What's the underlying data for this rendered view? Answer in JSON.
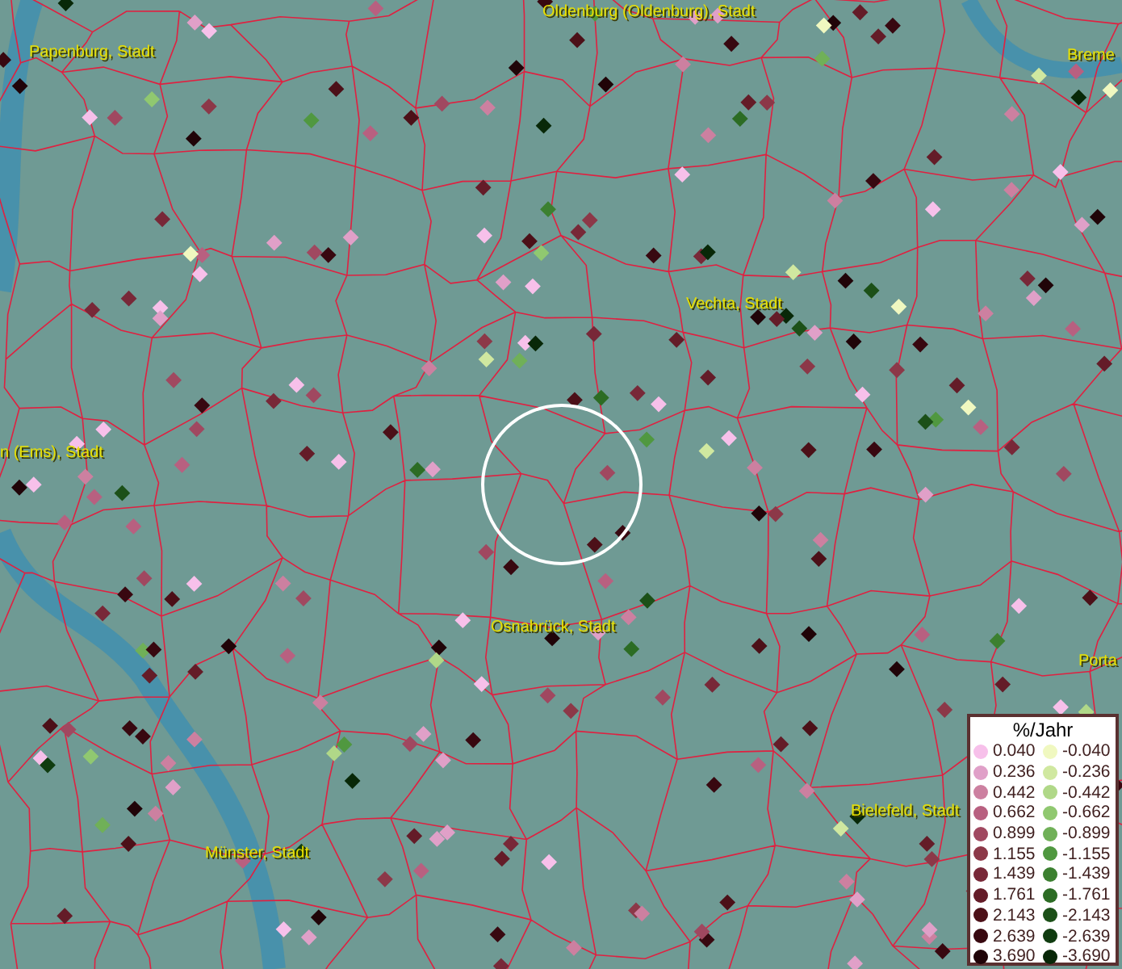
{
  "map": {
    "places": [
      {
        "name": "Oldenburg (Oldenburg), Stadt"
      },
      {
        "name": "Papenburg, Stadt"
      },
      {
        "name": "Breme"
      },
      {
        "name": "Vechta, Stadt"
      },
      {
        "name": "n (Ems), Stadt"
      },
      {
        "name": "Osnabrück, Stadt"
      },
      {
        "name": "Porta"
      },
      {
        "name": "Bielefeld, Stadt"
      },
      {
        "name": "Münster, Stadt"
      }
    ]
  },
  "legend": {
    "title": "%/Jahr",
    "entries": [
      {
        "label": "0.040",
        "color": "#f7c0ea"
      },
      {
        "label": "-0.040",
        "color": "#f0f8c0"
      },
      {
        "label": "0.236",
        "color": "#e0a0c8"
      },
      {
        "label": "-0.236",
        "color": "#d0e8a0"
      },
      {
        "label": "0.442",
        "color": "#cc80a0"
      },
      {
        "label": "-0.442",
        "color": "#b0d888"
      },
      {
        "label": "0.662",
        "color": "#b86080"
      },
      {
        "label": "-0.662",
        "color": "#90c870"
      },
      {
        "label": "0.899",
        "color": "#a04860"
      },
      {
        "label": "-0.899",
        "color": "#70b058"
      },
      {
        "label": "1.155",
        "color": "#8c3848"
      },
      {
        "label": "-1.155",
        "color": "#509840"
      },
      {
        "label": "1.439",
        "color": "#782838"
      },
      {
        "label": "-1.439",
        "color": "#3c8030"
      },
      {
        "label": "1.761",
        "color": "#641c28"
      },
      {
        "label": "-1.761",
        "color": "#2c6c24"
      },
      {
        "label": "2.143",
        "color": "#4c1018"
      },
      {
        "label": "-2.143",
        "color": "#1c5018"
      },
      {
        "label": "2.639",
        "color": "#380810"
      },
      {
        "label": "-2.639",
        "color": "#103c10"
      },
      {
        "label": "3.690",
        "color": "#200408"
      },
      {
        "label": "-3.690",
        "color": "#082808"
      }
    ]
  }
}
